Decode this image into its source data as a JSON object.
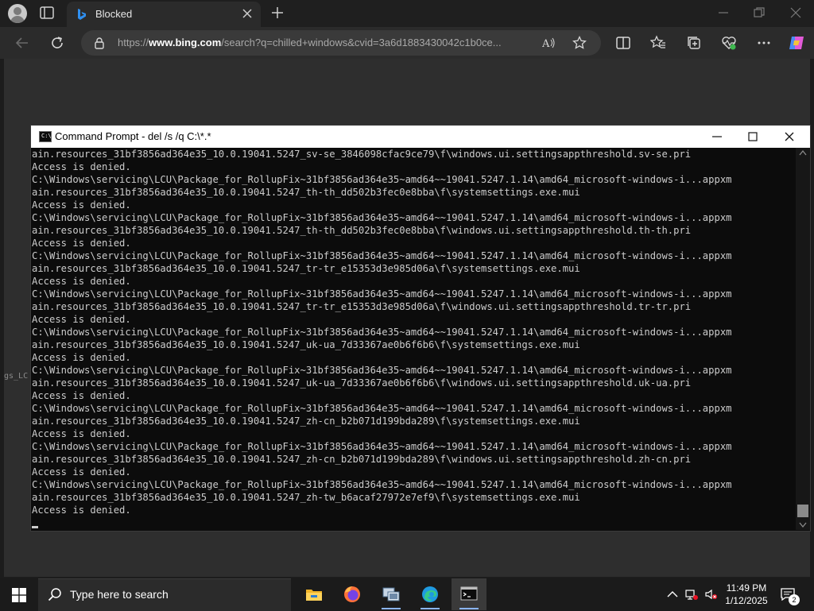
{
  "browser": {
    "tab_title": "Blocked",
    "url_prefix": "https://",
    "url_host": "www.bing.com",
    "url_rest": "/search?q=chilled+windows&cvid=3a6d1883430042c1b0ce...",
    "colors": {
      "chrome": "#1f1f1f",
      "toolbar": "#2b2b2b",
      "address": "#3a3a3a"
    }
  },
  "page": {
    "side_text": "gs_LC"
  },
  "cmd": {
    "title": "Command Prompt - del  /s /q C:\\*.*",
    "lines": [
      "ain.resources_31bf3856ad364e35_10.0.19041.5247_sv-se_3846098cfac9ce79\\f\\windows.ui.settingsappthreshold.sv-se.pri",
      "Access is denied.",
      "C:\\Windows\\servicing\\LCU\\Package_for_RollupFix~31bf3856ad364e35~amd64~~19041.5247.1.14\\amd64_microsoft-windows-i...appxm",
      "ain.resources_31bf3856ad364e35_10.0.19041.5247_th-th_dd502b3fec0e8bba\\f\\systemsettings.exe.mui",
      "Access is denied.",
      "C:\\Windows\\servicing\\LCU\\Package_for_RollupFix~31bf3856ad364e35~amd64~~19041.5247.1.14\\amd64_microsoft-windows-i...appxm",
      "ain.resources_31bf3856ad364e35_10.0.19041.5247_th-th_dd502b3fec0e8bba\\f\\windows.ui.settingsappthreshold.th-th.pri",
      "Access is denied.",
      "C:\\Windows\\servicing\\LCU\\Package_for_RollupFix~31bf3856ad364e35~amd64~~19041.5247.1.14\\amd64_microsoft-windows-i...appxm",
      "ain.resources_31bf3856ad364e35_10.0.19041.5247_tr-tr_e15353d3e985d06a\\f\\systemsettings.exe.mui",
      "Access is denied.",
      "C:\\Windows\\servicing\\LCU\\Package_for_RollupFix~31bf3856ad364e35~amd64~~19041.5247.1.14\\amd64_microsoft-windows-i...appxm",
      "ain.resources_31bf3856ad364e35_10.0.19041.5247_tr-tr_e15353d3e985d06a\\f\\windows.ui.settingsappthreshold.tr-tr.pri",
      "Access is denied.",
      "C:\\Windows\\servicing\\LCU\\Package_for_RollupFix~31bf3856ad364e35~amd64~~19041.5247.1.14\\amd64_microsoft-windows-i...appxm",
      "ain.resources_31bf3856ad364e35_10.0.19041.5247_uk-ua_7d33367ae0b6f6b6\\f\\systemsettings.exe.mui",
      "Access is denied.",
      "C:\\Windows\\servicing\\LCU\\Package_for_RollupFix~31bf3856ad364e35~amd64~~19041.5247.1.14\\amd64_microsoft-windows-i...appxm",
      "ain.resources_31bf3856ad364e35_10.0.19041.5247_uk-ua_7d33367ae0b6f6b6\\f\\windows.ui.settingsappthreshold.uk-ua.pri",
      "Access is denied.",
      "C:\\Windows\\servicing\\LCU\\Package_for_RollupFix~31bf3856ad364e35~amd64~~19041.5247.1.14\\amd64_microsoft-windows-i...appxm",
      "ain.resources_31bf3856ad364e35_10.0.19041.5247_zh-cn_b2b071d199bda289\\f\\systemsettings.exe.mui",
      "Access is denied.",
      "C:\\Windows\\servicing\\LCU\\Package_for_RollupFix~31bf3856ad364e35~amd64~~19041.5247.1.14\\amd64_microsoft-windows-i...appxm",
      "ain.resources_31bf3856ad364e35_10.0.19041.5247_zh-cn_b2b071d199bda289\\f\\windows.ui.settingsappthreshold.zh-cn.pri",
      "Access is denied.",
      "C:\\Windows\\servicing\\LCU\\Package_for_RollupFix~31bf3856ad364e35~amd64~~19041.5247.1.14\\amd64_microsoft-windows-i...appxm",
      "ain.resources_31bf3856ad364e35_10.0.19041.5247_zh-tw_b6acaf27972e7ef9\\f\\systemsettings.exe.mui",
      "Access is denied."
    ],
    "colors": {
      "background": "#0c0c0c",
      "text": "#cccccc"
    }
  },
  "taskbar": {
    "search_placeholder": "Type here to search",
    "time": "11:49 PM",
    "date": "1/12/2025",
    "notification_count": "2",
    "apps": [
      "file-explorer-icon",
      "firefox-icon",
      "remote-desktop-icon",
      "edge-icon",
      "command-prompt-icon"
    ]
  }
}
